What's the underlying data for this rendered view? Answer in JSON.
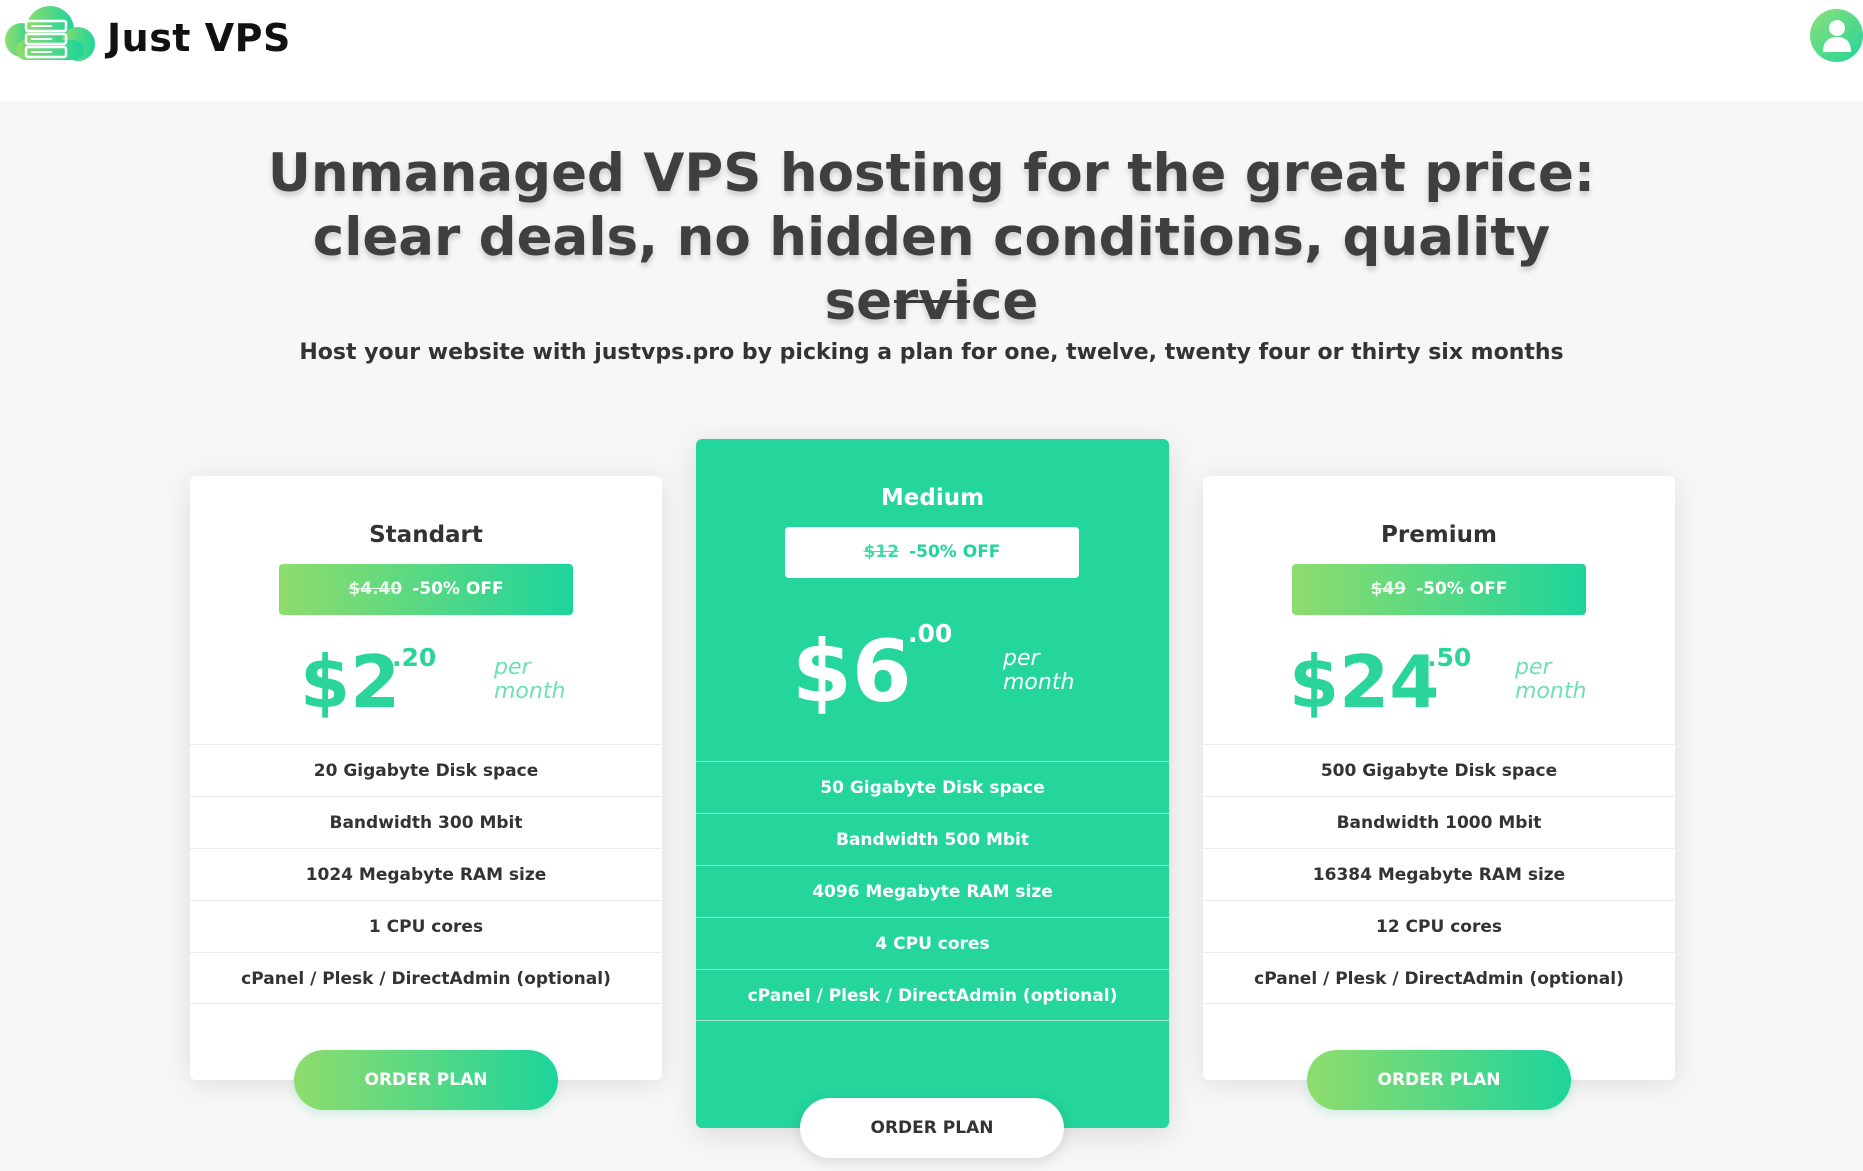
{
  "header": {
    "brand": "Just VPS",
    "logo_icon": "cloud-server-icon",
    "user_icon": "user-icon",
    "accent_color": "#24d59c"
  },
  "hero": {
    "headline": "Unmanaged VPS hosting for the great price: clear deals, no hidden conditions, quality service",
    "subline": "Host your website with justvps.pro by picking a plan for one, twelve, twenty four or thirty six months"
  },
  "plans": [
    {
      "name": "Standart",
      "old_price": "$4.40",
      "discount": "-50% OFF",
      "price_main": "$2",
      "price_cents": ".20",
      "per": "per",
      "period": "month",
      "features": [
        "20 Gigabyte Disk space",
        "Bandwidth 300 Mbit",
        "1024 Megabyte RAM size",
        "1 CPU cores",
        "cPanel / Plesk / DirectAdmin (optional)"
      ],
      "order_label": "ORDER PLAN"
    },
    {
      "name": "Medium",
      "old_price": "$12",
      "discount": "-50% OFF",
      "price_main": "$6",
      "price_cents": ".00",
      "per": "per",
      "period": "month",
      "features": [
        "50 Gigabyte Disk space",
        "Bandwidth 500 Mbit",
        "4096 Megabyte RAM size",
        "4 CPU cores",
        "cPanel / Plesk / DirectAdmin (optional)"
      ],
      "order_label": "ORDER PLAN"
    },
    {
      "name": "Premium",
      "old_price": "$49",
      "discount": "-50% OFF",
      "price_main": "$24",
      "price_cents": ".50",
      "per": "per",
      "period": "month",
      "features": [
        "500 Gigabyte Disk space",
        "Bandwidth 1000 Mbit",
        "16384 Megabyte RAM size",
        "12 CPU cores",
        "cPanel / Plesk / DirectAdmin (optional)"
      ],
      "order_label": "ORDER PLAN"
    }
  ]
}
